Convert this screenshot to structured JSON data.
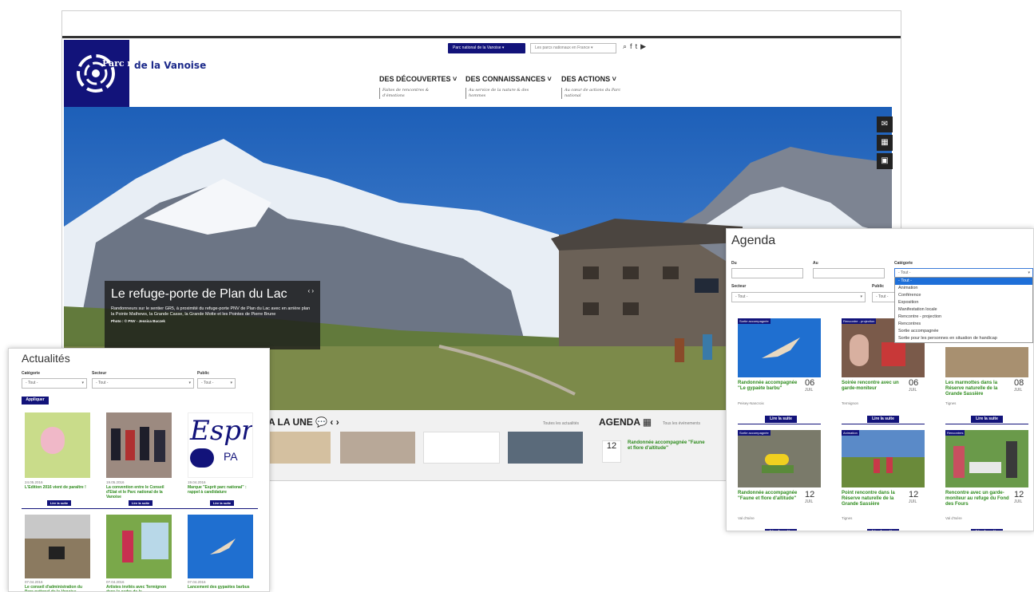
{
  "header": {
    "logo_line1": "Parc national",
    "logo_line2": "de la Vanoise",
    "parc_selector": "Parc national de la Vanoise",
    "parcs_france": "Les parcs nationaux en France"
  },
  "menu": [
    {
      "label": "DES DÉCOUVERTES",
      "sub": "Faites de rencontres & d'émotions"
    },
    {
      "label": "DES CONNAISSANCES",
      "sub": "Au service de la nature & des hommes"
    },
    {
      "label": "DES ACTIONS",
      "sub": "Au cœur de actions du Parc national"
    }
  ],
  "hero": {
    "title": "Le refuge-porte de Plan du Lac",
    "text": "Randonneurs sur le sentier GR5, à proximité du refuge-porte PNV de Plan du Lac avec en arrière plan la Pointe Mathews, la Grande Casse, la Grande Motte et les Pointes de Pierre Brune",
    "credit": "Photo : © PNV - Jessica Buczek"
  },
  "bottom": {
    "a_la_une": "A LA UNE",
    "toutes_actualites": "Toutes les actualités",
    "agenda": "AGENDA",
    "tout_evenements": "Tous les événements",
    "agenda_day": "12",
    "agenda_title": "Randonnée accompagnée \"Faune et flore d'altitude\""
  },
  "actualites": {
    "title": "Actualités",
    "filters": [
      {
        "label": "Catégorie",
        "value": "- Tout -"
      },
      {
        "label": "Secteur",
        "value": "- Tout -"
      },
      {
        "label": "Public",
        "value": "- Tout -"
      }
    ],
    "apply": "Appliquer",
    "read_more": "Lire la suite",
    "items": [
      {
        "date": "24.05.2016",
        "title": "L'Edition 2016 vient de paraître !"
      },
      {
        "date": "19.05.2016",
        "title": "La convention entre le Conseil d'Etat et le Parc national de la Vanoise"
      },
      {
        "date": "19.04.2016",
        "title": "Marque \"Esprit parc national\" : rappel à candidature"
      },
      {
        "date": "07.04.2016",
        "title": "Le conseil d'administration du Parc national de la Vanoise"
      },
      {
        "date": "07.04.2016",
        "title": "Artistes invités avec Termignon dans la cadre de la"
      },
      {
        "date": "07.04.2016",
        "title": "Lancement des gypaètes barbus"
      }
    ]
  },
  "agenda": {
    "title": "Agenda",
    "du": "Du",
    "au": "Au",
    "categorie": "Catégorie",
    "categorie_value": "- Tout -",
    "secteur": "Secteur",
    "secteur_value": "- Tout -",
    "public": "Public",
    "public_value": "- Tout -",
    "dropdown_options": [
      "- Tout -",
      "Animation",
      "Conférence",
      "Exposition",
      "Manifestation locale",
      "Rencontre - projection",
      "Rencontres",
      "Sortie accompagnée",
      "Sortie pour les personnes en situation de handicap"
    ],
    "read_more": "Lire la suite",
    "cards": [
      {
        "tag": "Sortie accompagnée",
        "title": "Randonnée accompagnée \"Le gypaète barbu\"",
        "place": "Peisey-Nancroix",
        "day": "06",
        "month": "JUIL"
      },
      {
        "tag": "Rencontre - projection",
        "title": "Soirée rencontre avec un garde-moniteur",
        "place": "Termignon",
        "day": "06",
        "month": "JUIL"
      },
      {
        "tag": "",
        "title": "Les marmottes dans la Réserve naturelle de la Grande Sassière",
        "place": "Tignes",
        "day": "08",
        "month": "JUIL"
      },
      {
        "tag": "Sortie accompagnée",
        "title": "Randonnée accompagnée \"Faune et flore d'altitude\"",
        "place": "Val d'Isère",
        "day": "12",
        "month": "JUIL"
      },
      {
        "tag": "Animation",
        "title": "Point rencontre dans la Réserve naturelle de la Grande Sassière",
        "place": "Tignes",
        "day": "12",
        "month": "JUIL"
      },
      {
        "tag": "Rencontres",
        "title": "Rencontre avec un garde-moniteur au refuge du Fond des Fours",
        "place": "Val d'Isère",
        "day": "12",
        "month": "JUIL"
      }
    ]
  }
}
